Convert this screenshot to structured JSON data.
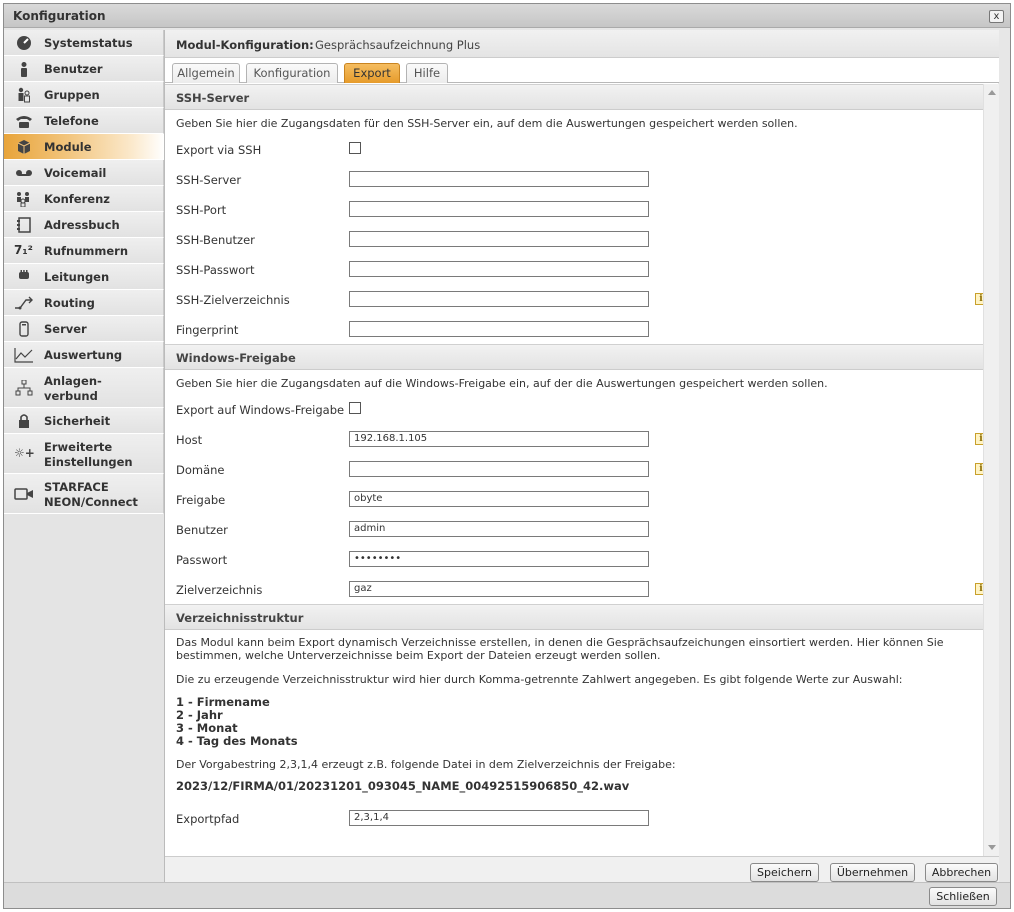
{
  "window": {
    "title": "Konfiguration",
    "close_label": "x"
  },
  "sidebar": {
    "items": [
      {
        "label": "Systemstatus",
        "icon": "gauge-icon"
      },
      {
        "label": "Benutzer",
        "icon": "user-icon"
      },
      {
        "label": "Gruppen",
        "icon": "group-icon"
      },
      {
        "label": "Telefone",
        "icon": "phone-icon"
      },
      {
        "label": "Module",
        "icon": "module-cube-icon",
        "active": true
      },
      {
        "label": "Voicemail",
        "icon": "voicemail-icon"
      },
      {
        "label": "Konferenz",
        "icon": "conference-icon"
      },
      {
        "label": "Adressbuch",
        "icon": "addressbook-icon"
      },
      {
        "label": "Rufnummern",
        "icon": "numbers-icon",
        "glyph": "7₁²"
      },
      {
        "label": "Leitungen",
        "icon": "plug-icon"
      },
      {
        "label": "Routing",
        "icon": "routing-icon"
      },
      {
        "label": "Server",
        "icon": "server-icon"
      },
      {
        "label": "Auswertung",
        "icon": "chart-icon"
      },
      {
        "label_lines": [
          "Anlagen-",
          "verbund"
        ],
        "icon": "network-icon"
      },
      {
        "label": "Sicherheit",
        "icon": "lock-icon"
      },
      {
        "label_lines": [
          "Erweiterte",
          "Einstellungen"
        ],
        "icon": "advanced-settings-icon",
        "glyph": "☼+"
      },
      {
        "label_lines": [
          "STARFACE",
          "NEON/Connect"
        ],
        "icon": "camera-icon"
      }
    ]
  },
  "module_header": {
    "key": "Modul-Konfiguration:",
    "value": "Gesprächsaufzeichnung Plus"
  },
  "tabs": [
    {
      "label": "Allgemein"
    },
    {
      "label": "Konfiguration"
    },
    {
      "label": "Export",
      "active": true
    },
    {
      "label": "Hilfe"
    }
  ],
  "ssh": {
    "header": "SSH-Server",
    "description": "Geben Sie hier die Zugangsdaten für den SSH-Server ein, auf dem die Auswertungen gespeichert werden sollen.",
    "export_label": "Export via SSH",
    "fields": [
      {
        "label": "SSH-Server",
        "value": ""
      },
      {
        "label": "SSH-Port",
        "value": ""
      },
      {
        "label": "SSH-Benutzer",
        "value": ""
      },
      {
        "label": "SSH-Passwort",
        "value": ""
      },
      {
        "label": "SSH-Zielverzeichnis",
        "value": ""
      },
      {
        "label": "Fingerprint",
        "value": ""
      }
    ]
  },
  "windows": {
    "header": "Windows-Freigabe",
    "description": "Geben Sie hier die Zugangsdaten auf die Windows-Freigabe ein, auf der die Auswertungen gespeichert werden sollen.",
    "export_label": "Export auf Windows-Freigabe",
    "fields": [
      {
        "label": "Host",
        "value": "192.168.1.105"
      },
      {
        "label": "Domäne",
        "value": ""
      },
      {
        "label": "Freigabe",
        "value": "obyte"
      },
      {
        "label": "Benutzer",
        "value": "admin"
      },
      {
        "label": "Passwort",
        "value": "••••••••"
      },
      {
        "label": "Zielverzeichnis",
        "value": "gaz"
      }
    ]
  },
  "dirs": {
    "header": "Verzeichnisstruktur",
    "para1": "Das Modul kann beim Export dynamisch Verzeichnisse erstellen, in denen die Gesprächsaufzeichungen einsortiert werden. Hier können Sie bestimmen, welche Unterverzeichnisse beim Export der Dateien erzeugt werden sollen.",
    "para2": "Die zu erzeugende Verzeichnisstruktur wird hier durch Komma-getrennte Zahlwert angegeben. Es gibt folgende Werte zur Auswahl:",
    "options": [
      "1 - Firmename",
      "2 - Jahr",
      "3 - Monat",
      "4 - Tag des Monats"
    ],
    "para3": "Der Vorgabestring 2,3,1,4 erzeugt z.B. folgende Datei in dem Zielverzeichnis der Freigabe:",
    "example": "2023/12/FIRMA/01/20231201_093045_NAME_00492515906850_42.wav",
    "exportpfad_label": "Exportpfad",
    "exportpfad_value": "2,3,1,4"
  },
  "buttons": {
    "save": "Speichern",
    "apply": "Übernehmen",
    "cancel": "Abbrechen",
    "close": "Schließen"
  },
  "info_glyph": "i"
}
